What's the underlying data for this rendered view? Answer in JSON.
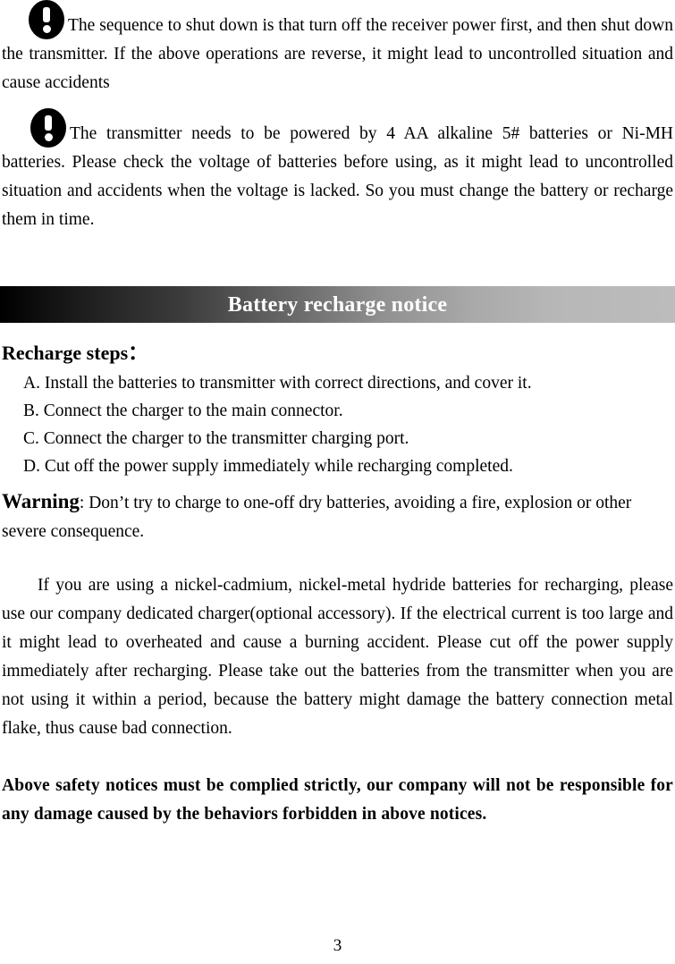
{
  "document": {
    "notices": [
      {
        "icon": "warning-exclamation-icon",
        "text": "The sequence to shut down is that turn off the receiver power first, and then shut down the transmitter. If the above operations are reverse, it might lead to uncontrolled situation and cause accidents"
      },
      {
        "icon": "warning-exclamation-icon",
        "text": "The transmitter needs to be powered by 4 AA alkaline 5# batteries or Ni-MH batteries. Please check the voltage of batteries before using, as it might lead to uncontrolled situation and accidents when the voltage is lacked. So you must change the battery or recharge them in time."
      }
    ],
    "banner": {
      "title": "Battery recharge notice",
      "gradient_start": "#000000",
      "gradient_end": "#bcbcbc",
      "text_color": "#ffffff"
    },
    "recharge_steps": {
      "heading": "Recharge steps：",
      "items": [
        "A. Install the batteries to transmitter with correct directions, and cover it.",
        "B. Connect the charger to the main connector.",
        "C. Connect the charger to the transmitter charging port.",
        "D. Cut off the power supply immediately while recharging completed."
      ]
    },
    "warning": {
      "label": "Warning",
      "text": ": Don’t try to charge to one-off dry batteries, avoiding a fire, explosion or other severe consequence."
    },
    "nickel_paragraph": "If you are using a nickel-cadmium, nickel-metal hydride batteries for recharging, please use our company dedicated charger(optional accessory). If the electrical current is too large and it might lead to overheated and cause a burning accident. Please cut off the power supply immediately after recharging. Please take out the batteries from the transmitter when you are not using it within a period, because the battery might damage the battery connection metal flake, thus cause bad connection.",
    "final_paragraph": "Above safety notices must be complied strictly, our company will not be responsible for any damage caused by the behaviors forbidden in above notices.",
    "page_number": "3"
  }
}
